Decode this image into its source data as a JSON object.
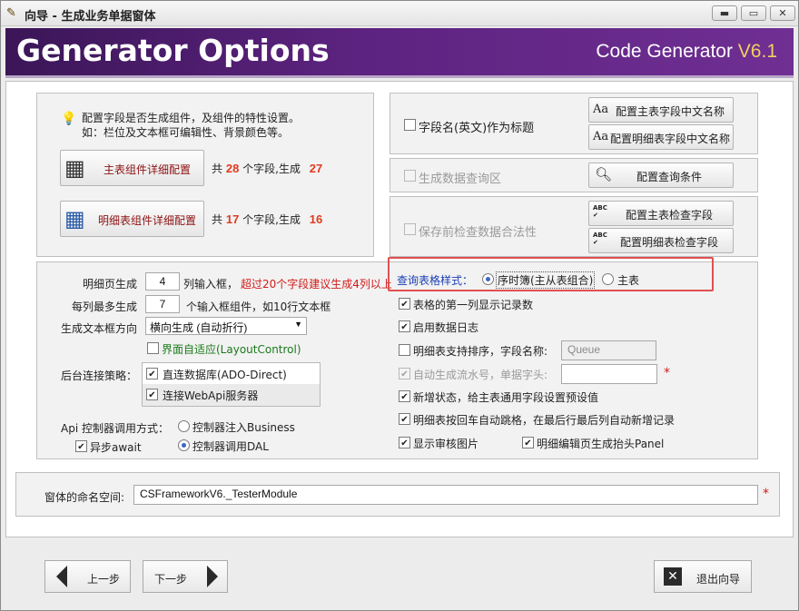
{
  "window": {
    "title": "向导 - 生成业务单据窗体",
    "minimize": "▬",
    "maximize": "▭",
    "close": "✕"
  },
  "banner": {
    "title": "Generator Options",
    "product": "Code Generator ",
    "version": "V6.1"
  },
  "info": {
    "line1": "配置字段是否生成组件，及组件的特性设置。",
    "line2": "如：栏位及文本框可编辑性、背景颜色等。"
  },
  "master": {
    "button": "主表组件详细配置",
    "prefix": "共",
    "fields": "28",
    "middle": "个字段,生成",
    "generated": "27"
  },
  "detail": {
    "button": "明细表组件详细配置",
    "prefix": "共",
    "fields": "17",
    "middle": "个字段,生成",
    "generated": "16"
  },
  "right_top": {
    "field_title_label": "字段名(英文)作为标题",
    "btn_master_cn": "配置主表字段中文名称",
    "btn_detail_cn": "配置明细表字段中文名称",
    "btn_aa": "Aa",
    "query_area_label": "生成数据查询区",
    "btn_query": "配置查询条件",
    "validate_label": "保存前检查数据合法性",
    "btn_master_check": "配置主表检查字段",
    "btn_detail_check": "配置明细表检查字段",
    "abc": "ABC"
  },
  "left_opts": {
    "detail_page_label": "明细页生成",
    "detail_page_value": "4",
    "detail_page_suffix": "列输入框，",
    "detail_page_warn": "超过20个字段建议生成4列以上",
    "per_col_label": "每列最多生成",
    "per_col_value": "7",
    "per_col_suffix": "个输入框组件，如10行文本框",
    "direction_label": "生成文本框方向",
    "direction_value": "横向生成 (自动折行)",
    "adaptive_label": "界面自适应(LayoutControl)",
    "backend_label": "后台连接策略：",
    "backend_opt1": "直连数据库(ADO-Direct)",
    "backend_opt2": "连接WebApi服务器",
    "api_label": "Api 控制器调用方式：",
    "api_opt1": "控制器注入Business",
    "api_opt2": "控制器调用DAL",
    "async_label": "异步await"
  },
  "right_opts": {
    "query_style_label": "查询表格样式：",
    "query_style_opt1": "序时簿(主从表组合)",
    "query_style_opt2": "主表",
    "opt_first_col": "表格的第一列显示记录数",
    "opt_log": "启用数据日志",
    "opt_sort": "明细表支持排序，字段名称:",
    "sort_field": "Queue",
    "opt_serial": "自动生成流水号，单据字头:",
    "serial_value": "",
    "opt_new_state": "新增状态，给主表通用字段设置预设值",
    "opt_enter": "明细表按回车自动跳格，在最后行最后列自动新增记录",
    "opt_audit": "显示审核图片",
    "opt_panel": "明细编辑页生成抬头Panel",
    "required_mark": "*"
  },
  "namespace": {
    "label": "窗体的命名空间:",
    "value": "CSFrameworkV6._TesterModule",
    "required_mark": "*"
  },
  "footer": {
    "prev": "上一步",
    "next": "下一步",
    "exit": "退出向导"
  }
}
